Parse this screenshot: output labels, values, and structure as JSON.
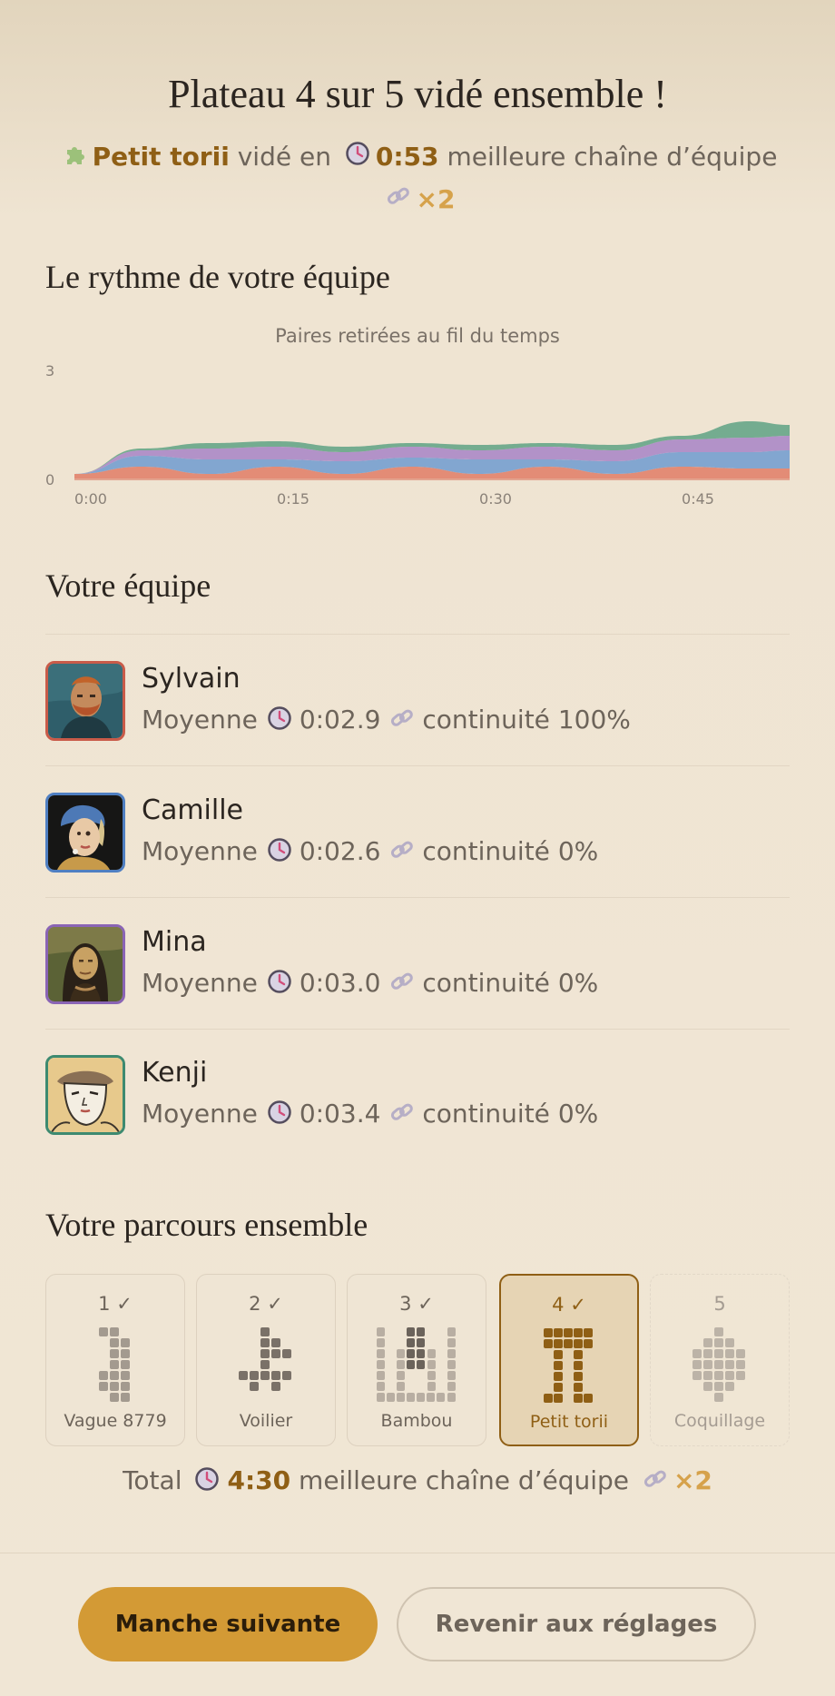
{
  "header": {
    "title": "Plateau 4 sur 5 vidé ensemble !",
    "puzzle_icon": "puzzle-icon",
    "puzzle_name": "Petit torii",
    "cleared_in": "vidé en",
    "time": "0:53",
    "best_chain_label": "meilleure chaîne d’équipe",
    "best_chain": "×2"
  },
  "rhythm": {
    "heading": "Le rythme de votre équipe",
    "chart_data": {
      "type": "area",
      "title": "Paires retirées au fil du temps",
      "stacked": true,
      "ylim": [
        0,
        3
      ],
      "yticks": [
        "0",
        "3"
      ],
      "xticks": [
        "0:00",
        "0:15",
        "0:30",
        "0:45"
      ],
      "x": [
        0,
        5,
        10,
        15,
        20,
        25,
        30,
        35,
        40,
        45,
        50,
        53
      ],
      "series": [
        {
          "color": "#e07d66",
          "values": [
            0.15,
            0.35,
            0.15,
            0.35,
            0.15,
            0.35,
            0.15,
            0.35,
            0.15,
            0.35,
            0.3,
            0.3
          ]
        },
        {
          "color": "#6e9bd0",
          "values": [
            0.0,
            0.3,
            0.4,
            0.2,
            0.35,
            0.25,
            0.4,
            0.2,
            0.35,
            0.4,
            0.45,
            0.5
          ]
        },
        {
          "color": "#a784c7",
          "values": [
            0.0,
            0.15,
            0.3,
            0.35,
            0.25,
            0.3,
            0.25,
            0.35,
            0.3,
            0.35,
            0.4,
            0.4
          ]
        },
        {
          "color": "#5ea284",
          "values": [
            0.0,
            0.05,
            0.15,
            0.15,
            0.15,
            0.1,
            0.15,
            0.1,
            0.15,
            0.1,
            0.45,
            0.3
          ]
        }
      ]
    }
  },
  "team": {
    "heading": "Votre équipe",
    "members": [
      {
        "name": "Sylvain",
        "avg_label": "Moyenne",
        "avg": "0:02.9",
        "continuity": "continuité 100%",
        "color": "#c95b49"
      },
      {
        "name": "Camille",
        "avg_label": "Moyenne",
        "avg": "0:02.6",
        "continuity": "continuité 0%",
        "color": "#4f7fc2"
      },
      {
        "name": "Mina",
        "avg_label": "Moyenne",
        "avg": "0:03.0",
        "continuity": "continuité 0%",
        "color": "#8a64b5"
      },
      {
        "name": "Kenji",
        "avg_label": "Moyenne",
        "avg": "0:03.4",
        "continuity": "continuité 0%",
        "color": "#3d8a70"
      }
    ]
  },
  "journey": {
    "heading": "Votre parcours ensemble",
    "levels": [
      {
        "num": "1 ✓",
        "name": "Vague 8779",
        "state": "done"
      },
      {
        "num": "2 ✓",
        "name": "Voilier",
        "state": "done"
      },
      {
        "num": "3 ✓",
        "name": "Bambou",
        "state": "done"
      },
      {
        "num": "4 ✓",
        "name": "Petit torii",
        "state": "current"
      },
      {
        "num": "5",
        "name": "Coquillage",
        "state": "locked"
      }
    ],
    "total_label": "Total",
    "total_time": "4:30",
    "best_chain_label": "meilleure chaîne d’équipe",
    "best_chain": "×2"
  },
  "buttons": {
    "next": "Manche suivante",
    "back": "Revenir aux réglages"
  },
  "colors": {
    "accent": "#d39a35",
    "accent_text": "#8f5f15",
    "chain_gold": "#d6a24b"
  }
}
